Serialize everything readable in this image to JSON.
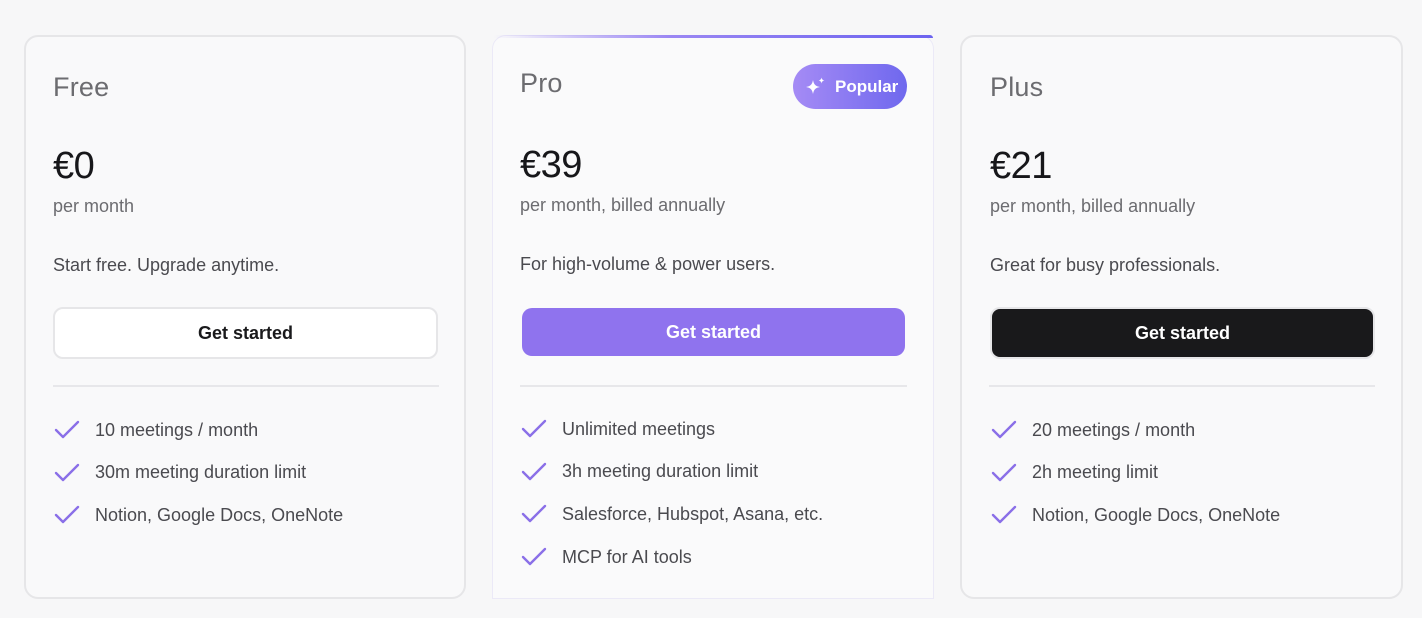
{
  "plans": [
    {
      "name": "Free",
      "price": "€0",
      "period": "per month",
      "description": "Start free. Upgrade anytime.",
      "cta": "Get started",
      "features": [
        "10 meetings / month",
        "30m meeting duration limit",
        "Notion, Google Docs, OneNote"
      ]
    },
    {
      "name": "Pro",
      "badge": "Popular",
      "price": "€39",
      "period": "per month, billed annually",
      "description": "For high-volume & power users.",
      "cta": "Get started",
      "features": [
        "Unlimited meetings",
        "3h meeting duration limit",
        "Salesforce, Hubspot, Asana, etc.",
        "MCP for AI tools"
      ]
    },
    {
      "name": "Plus",
      "price": "€21",
      "period": "per month, billed annually",
      "description": "Great for busy professionals.",
      "cta": "Get started",
      "features": [
        "20 meetings / month",
        "2h meeting limit",
        "Notion, Google Docs, OneNote"
      ]
    }
  ],
  "colors": {
    "accent": "#8f73ee",
    "check": "#8a6fe8",
    "dark_button": "#19191b",
    "badge_start": "#a58bf5",
    "badge_end": "#6f68ee"
  },
  "icons": {
    "feature": "check-icon",
    "badge": "sparkle-icon"
  }
}
